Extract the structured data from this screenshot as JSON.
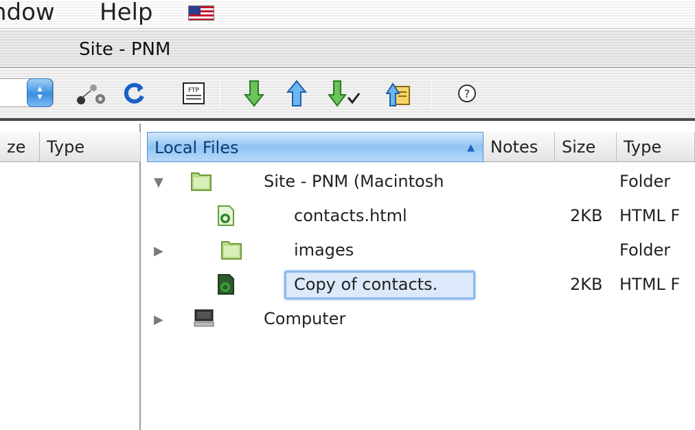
{
  "menubar": {
    "items": [
      "ndow",
      "Help"
    ],
    "flag_icon": "us-flag-icon"
  },
  "window": {
    "title": "Site - PNM"
  },
  "toolbar": {
    "buttons": [
      "site-popup",
      "connect-icon",
      "refresh-icon",
      "ftp-log-icon",
      "get-icon",
      "put-icon",
      "check-out-icon",
      "check-in-icon",
      "help-icon"
    ],
    "ftp_label": "FTP",
    "help_glyph": "?"
  },
  "left_pane": {
    "columns": [
      "ze",
      "Type"
    ]
  },
  "right_pane": {
    "columns": [
      "Local Files",
      "Notes",
      "Size",
      "Type"
    ],
    "rows": [
      {
        "name": "Site - PNM (Macintosh",
        "size": "",
        "type": "Folder",
        "kind": "folder",
        "expanded": true
      },
      {
        "name": "contacts.html",
        "size": "2KB",
        "type": "HTML F",
        "kind": "html"
      },
      {
        "name": "images",
        "size": "",
        "type": "Folder",
        "kind": "folder",
        "expanded": false
      },
      {
        "name": "Copy of contacts.",
        "size": "2KB",
        "type": "HTML F",
        "kind": "html",
        "editing": true
      },
      {
        "name": "Computer",
        "size": "",
        "type": "",
        "kind": "computer",
        "expanded": false
      }
    ]
  },
  "colors": {
    "header_active": "#8fc3f2",
    "arrow_green": "#3aa032",
    "arrow_blue": "#2e8fe0",
    "folder_green": "#b7dc8a"
  }
}
